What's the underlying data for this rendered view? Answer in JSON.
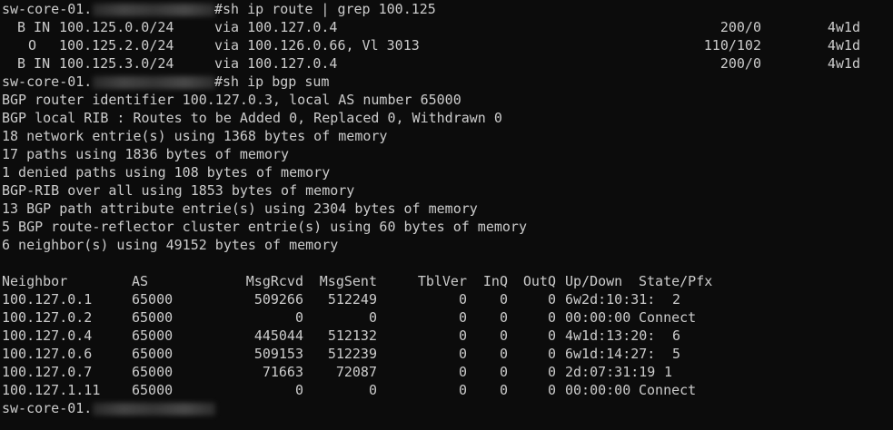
{
  "prompt": {
    "host": "sw-core-01."
  },
  "commands": {
    "route": "#sh ip route | grep 100.125",
    "bgp": "#sh ip bgp sum"
  },
  "routes": [
    {
      "code": "B IN",
      "prefix": "100.125.0.0/24",
      "via": "via 100.127.0.4",
      "metric": "200/0",
      "age": "4w1d"
    },
    {
      "code": "O",
      "prefix": "100.125.2.0/24",
      "via": "via 100.126.0.66, Vl 3013",
      "metric": "110/102",
      "age": "4w1d"
    },
    {
      "code": "B IN",
      "prefix": "100.125.3.0/24",
      "via": "via 100.127.0.4",
      "metric": "200/0",
      "age": "4w1d"
    }
  ],
  "summary": [
    "BGP router identifier 100.127.0.3, local AS number 65000",
    "BGP local RIB : Routes to be Added 0, Replaced 0, Withdrawn 0",
    "18 network entrie(s) using 1368 bytes of memory",
    "17 paths using 1836 bytes of memory",
    "1 denied paths using 108 bytes of memory",
    "BGP-RIB over all using 1853 bytes of memory",
    "13 BGP path attribute entrie(s) using 2304 bytes of memory",
    "5 BGP route-reflector cluster entrie(s) using 60 bytes of memory",
    "6 neighbor(s) using 49152 bytes of memory"
  ],
  "neighbor_table": {
    "headers": {
      "neighbor": "Neighbor",
      "as": "AS",
      "rcvd": "MsgRcvd",
      "sent": "MsgSent",
      "tblver": "TblVer",
      "inq": "InQ",
      "outq": "OutQ",
      "updown": "Up/Down",
      "state": "State/Pfx"
    },
    "rows": [
      {
        "neighbor": "100.127.0.1",
        "as": "65000",
        "rcvd": "509266",
        "sent": "512249",
        "tblver": "0",
        "inq": "0",
        "outq": "0",
        "updown": "6w2d:10:31:",
        "state": "2"
      },
      {
        "neighbor": "100.127.0.2",
        "as": "65000",
        "rcvd": "0",
        "sent": "0",
        "tblver": "0",
        "inq": "0",
        "outq": "0",
        "updown": "00:00:00",
        "state": "Connect"
      },
      {
        "neighbor": "100.127.0.4",
        "as": "65000",
        "rcvd": "445044",
        "sent": "512132",
        "tblver": "0",
        "inq": "0",
        "outq": "0",
        "updown": "4w1d:13:20:",
        "state": "6"
      },
      {
        "neighbor": "100.127.0.6",
        "as": "65000",
        "rcvd": "509153",
        "sent": "512239",
        "tblver": "0",
        "inq": "0",
        "outq": "0",
        "updown": "6w1d:14:27:",
        "state": "5"
      },
      {
        "neighbor": "100.127.0.7",
        "as": "65000",
        "rcvd": "71663",
        "sent": "72087",
        "tblver": "0",
        "inq": "0",
        "outq": "0",
        "updown": "2d:07:31:19",
        "state": "1"
      },
      {
        "neighbor": "100.127.1.11",
        "as": "65000",
        "rcvd": "0",
        "sent": "0",
        "tblver": "0",
        "inq": "0",
        "outq": "0",
        "updown": "00:00:00",
        "state": "Connect"
      }
    ]
  },
  "colors": {
    "background": "#0c0c0c",
    "foreground": "#cccccc"
  }
}
